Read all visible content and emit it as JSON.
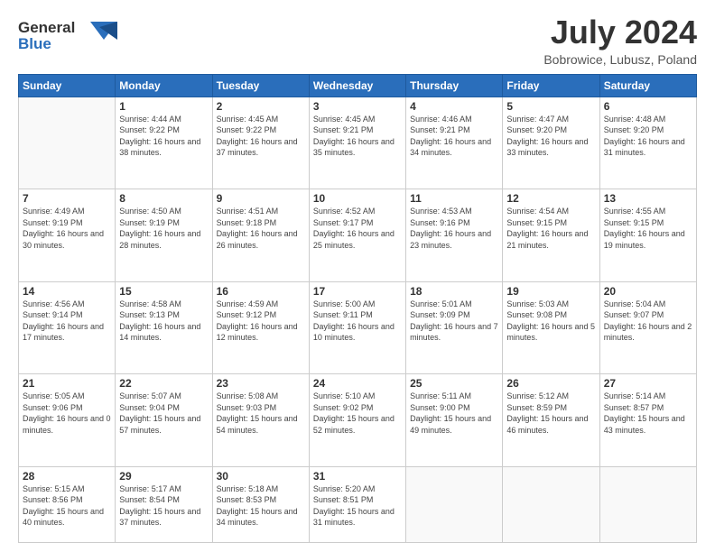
{
  "header": {
    "logo": {
      "general": "General",
      "blue": "Blue"
    },
    "title": "July 2024",
    "location": "Bobrowice, Lubusz, Poland"
  },
  "days_of_week": [
    "Sunday",
    "Monday",
    "Tuesday",
    "Wednesday",
    "Thursday",
    "Friday",
    "Saturday"
  ],
  "weeks": [
    [
      {
        "day": "",
        "sunrise": "",
        "sunset": "",
        "daylight": ""
      },
      {
        "day": "1",
        "sunrise": "4:44 AM",
        "sunset": "9:22 PM",
        "daylight": "16 hours and 38 minutes."
      },
      {
        "day": "2",
        "sunrise": "4:45 AM",
        "sunset": "9:22 PM",
        "daylight": "16 hours and 37 minutes."
      },
      {
        "day": "3",
        "sunrise": "4:45 AM",
        "sunset": "9:21 PM",
        "daylight": "16 hours and 35 minutes."
      },
      {
        "day": "4",
        "sunrise": "4:46 AM",
        "sunset": "9:21 PM",
        "daylight": "16 hours and 34 minutes."
      },
      {
        "day": "5",
        "sunrise": "4:47 AM",
        "sunset": "9:20 PM",
        "daylight": "16 hours and 33 minutes."
      },
      {
        "day": "6",
        "sunrise": "4:48 AM",
        "sunset": "9:20 PM",
        "daylight": "16 hours and 31 minutes."
      }
    ],
    [
      {
        "day": "7",
        "sunrise": "4:49 AM",
        "sunset": "9:19 PM",
        "daylight": "16 hours and 30 minutes."
      },
      {
        "day": "8",
        "sunrise": "4:50 AM",
        "sunset": "9:19 PM",
        "daylight": "16 hours and 28 minutes."
      },
      {
        "day": "9",
        "sunrise": "4:51 AM",
        "sunset": "9:18 PM",
        "daylight": "16 hours and 26 minutes."
      },
      {
        "day": "10",
        "sunrise": "4:52 AM",
        "sunset": "9:17 PM",
        "daylight": "16 hours and 25 minutes."
      },
      {
        "day": "11",
        "sunrise": "4:53 AM",
        "sunset": "9:16 PM",
        "daylight": "16 hours and 23 minutes."
      },
      {
        "day": "12",
        "sunrise": "4:54 AM",
        "sunset": "9:15 PM",
        "daylight": "16 hours and 21 minutes."
      },
      {
        "day": "13",
        "sunrise": "4:55 AM",
        "sunset": "9:15 PM",
        "daylight": "16 hours and 19 minutes."
      }
    ],
    [
      {
        "day": "14",
        "sunrise": "4:56 AM",
        "sunset": "9:14 PM",
        "daylight": "16 hours and 17 minutes."
      },
      {
        "day": "15",
        "sunrise": "4:58 AM",
        "sunset": "9:13 PM",
        "daylight": "16 hours and 14 minutes."
      },
      {
        "day": "16",
        "sunrise": "4:59 AM",
        "sunset": "9:12 PM",
        "daylight": "16 hours and 12 minutes."
      },
      {
        "day": "17",
        "sunrise": "5:00 AM",
        "sunset": "9:11 PM",
        "daylight": "16 hours and 10 minutes."
      },
      {
        "day": "18",
        "sunrise": "5:01 AM",
        "sunset": "9:09 PM",
        "daylight": "16 hours and 7 minutes."
      },
      {
        "day": "19",
        "sunrise": "5:03 AM",
        "sunset": "9:08 PM",
        "daylight": "16 hours and 5 minutes."
      },
      {
        "day": "20",
        "sunrise": "5:04 AM",
        "sunset": "9:07 PM",
        "daylight": "16 hours and 2 minutes."
      }
    ],
    [
      {
        "day": "21",
        "sunrise": "5:05 AM",
        "sunset": "9:06 PM",
        "daylight": "16 hours and 0 minutes."
      },
      {
        "day": "22",
        "sunrise": "5:07 AM",
        "sunset": "9:04 PM",
        "daylight": "15 hours and 57 minutes."
      },
      {
        "day": "23",
        "sunrise": "5:08 AM",
        "sunset": "9:03 PM",
        "daylight": "15 hours and 54 minutes."
      },
      {
        "day": "24",
        "sunrise": "5:10 AM",
        "sunset": "9:02 PM",
        "daylight": "15 hours and 52 minutes."
      },
      {
        "day": "25",
        "sunrise": "5:11 AM",
        "sunset": "9:00 PM",
        "daylight": "15 hours and 49 minutes."
      },
      {
        "day": "26",
        "sunrise": "5:12 AM",
        "sunset": "8:59 PM",
        "daylight": "15 hours and 46 minutes."
      },
      {
        "day": "27",
        "sunrise": "5:14 AM",
        "sunset": "8:57 PM",
        "daylight": "15 hours and 43 minutes."
      }
    ],
    [
      {
        "day": "28",
        "sunrise": "5:15 AM",
        "sunset": "8:56 PM",
        "daylight": "15 hours and 40 minutes."
      },
      {
        "day": "29",
        "sunrise": "5:17 AM",
        "sunset": "8:54 PM",
        "daylight": "15 hours and 37 minutes."
      },
      {
        "day": "30",
        "sunrise": "5:18 AM",
        "sunset": "8:53 PM",
        "daylight": "15 hours and 34 minutes."
      },
      {
        "day": "31",
        "sunrise": "5:20 AM",
        "sunset": "8:51 PM",
        "daylight": "15 hours and 31 minutes."
      },
      {
        "day": "",
        "sunrise": "",
        "sunset": "",
        "daylight": ""
      },
      {
        "day": "",
        "sunrise": "",
        "sunset": "",
        "daylight": ""
      },
      {
        "day": "",
        "sunrise": "",
        "sunset": "",
        "daylight": ""
      }
    ]
  ]
}
